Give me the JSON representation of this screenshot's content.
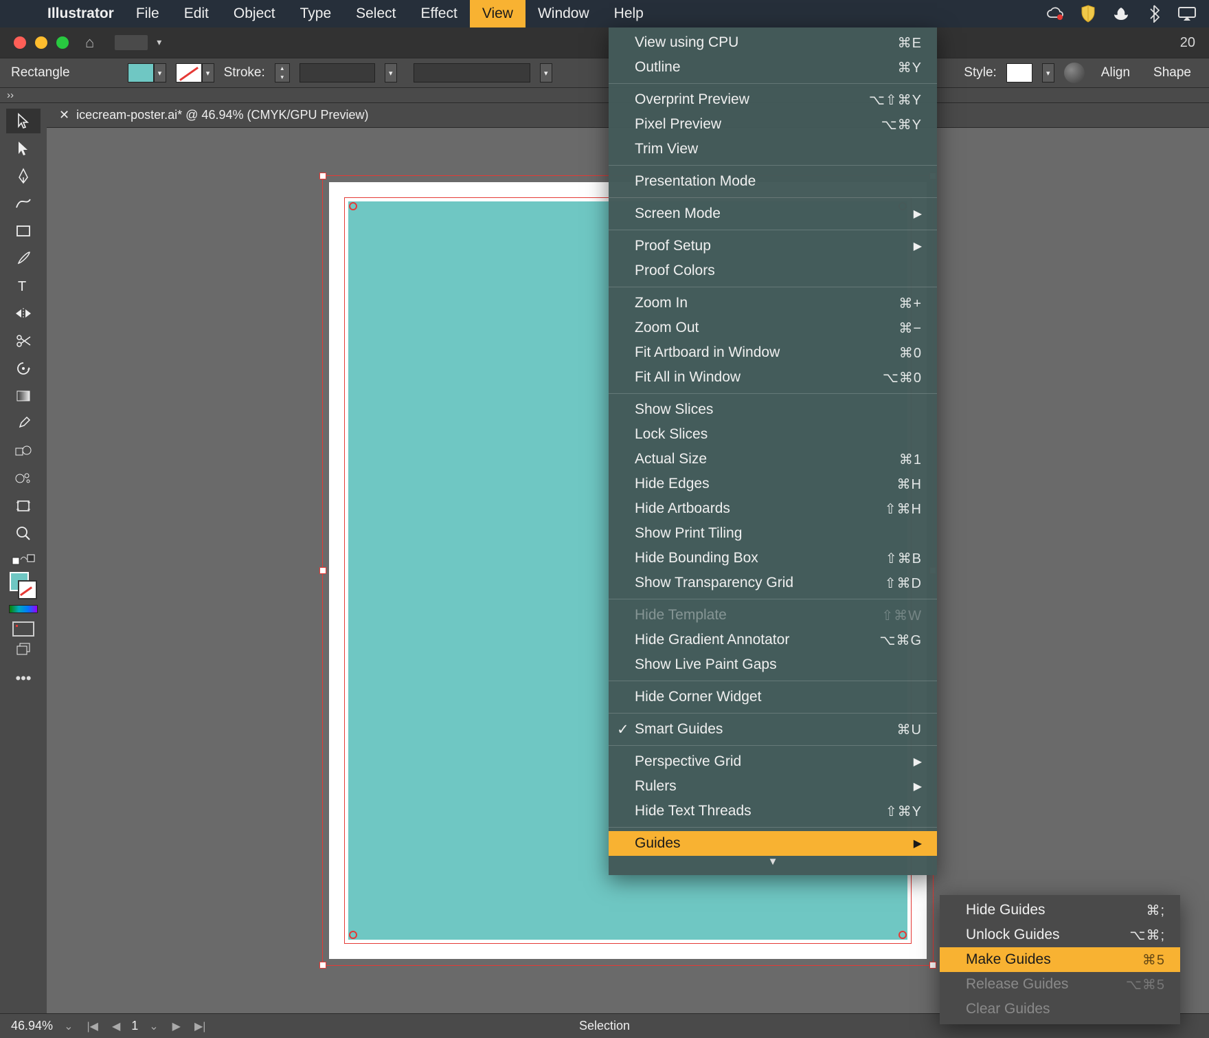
{
  "menubar": {
    "apple": "",
    "app": "Illustrator",
    "items": [
      "File",
      "Edit",
      "Object",
      "Type",
      "Select",
      "Effect",
      "View",
      "Window",
      "Help"
    ],
    "active_index": 6,
    "right_trail": "20"
  },
  "controlbar": {
    "tool_label": "Rectangle",
    "stroke_label": "Stroke:",
    "style_label": "Style:",
    "align_label": "Align",
    "shape_label": "Shape"
  },
  "tab": {
    "close": "✕",
    "title": "icecream-poster.ai* @ 46.94% (CMYK/GPU Preview)"
  },
  "statusbar": {
    "zoom": "46.94%",
    "artboard": "1",
    "mode": "Selection"
  },
  "view_menu": {
    "groups": [
      [
        {
          "label": "View using CPU",
          "sc": "⌘E"
        },
        {
          "label": "Outline",
          "sc": "⌘Y"
        }
      ],
      [
        {
          "label": "Overprint Preview",
          "sc": "⌥⇧⌘Y"
        },
        {
          "label": "Pixel Preview",
          "sc": "⌥⌘Y"
        },
        {
          "label": "Trim View",
          "sc": ""
        }
      ],
      [
        {
          "label": "Presentation Mode",
          "sc": ""
        }
      ],
      [
        {
          "label": "Screen Mode",
          "sc": "",
          "submenu": true
        }
      ],
      [
        {
          "label": "Proof Setup",
          "sc": "",
          "submenu": true
        },
        {
          "label": "Proof Colors",
          "sc": ""
        }
      ],
      [
        {
          "label": "Zoom In",
          "sc": "⌘+"
        },
        {
          "label": "Zoom Out",
          "sc": "⌘−"
        },
        {
          "label": "Fit Artboard in Window",
          "sc": "⌘0"
        },
        {
          "label": "Fit All in Window",
          "sc": "⌥⌘0"
        }
      ],
      [
        {
          "label": "Show Slices",
          "sc": ""
        },
        {
          "label": "Lock Slices",
          "sc": ""
        },
        {
          "label": "Actual Size",
          "sc": "⌘1"
        },
        {
          "label": "Hide Edges",
          "sc": "⌘H"
        },
        {
          "label": "Hide Artboards",
          "sc": "⇧⌘H"
        },
        {
          "label": "Show Print Tiling",
          "sc": ""
        },
        {
          "label": "Hide Bounding Box",
          "sc": "⇧⌘B"
        },
        {
          "label": "Show Transparency Grid",
          "sc": "⇧⌘D"
        }
      ],
      [
        {
          "label": "Hide Template",
          "sc": "⇧⌘W",
          "disabled": true
        },
        {
          "label": "Hide Gradient Annotator",
          "sc": "⌥⌘G"
        },
        {
          "label": "Show Live Paint Gaps",
          "sc": ""
        }
      ],
      [
        {
          "label": "Hide Corner Widget",
          "sc": ""
        }
      ],
      [
        {
          "label": "Smart Guides",
          "sc": "⌘U",
          "checked": true
        }
      ],
      [
        {
          "label": "Perspective Grid",
          "sc": "",
          "submenu": true
        },
        {
          "label": "Rulers",
          "sc": "",
          "submenu": true
        },
        {
          "label": "Hide Text Threads",
          "sc": "⇧⌘Y"
        }
      ],
      [
        {
          "label": "Guides",
          "sc": "",
          "submenu": true,
          "highlight": true
        }
      ]
    ]
  },
  "guides_submenu": [
    {
      "label": "Hide Guides",
      "sc": "⌘;"
    },
    {
      "label": "Unlock Guides",
      "sc": "⌥⌘;"
    },
    {
      "label": "Make Guides",
      "sc": "⌘5",
      "highlight": true
    },
    {
      "label": "Release Guides",
      "sc": "⌥⌘5",
      "disabled": true
    },
    {
      "label": "Clear Guides",
      "sc": "",
      "disabled": true
    }
  ],
  "tools": [
    "selection",
    "direct-selection",
    "pen",
    "curvature",
    "rectangle",
    "paintbrush",
    "type",
    "reflect",
    "scissors",
    "rotate",
    "gradient-mesh",
    "eyedropper",
    "blend",
    "symbol-sprayer",
    "artboard",
    "zoom"
  ]
}
